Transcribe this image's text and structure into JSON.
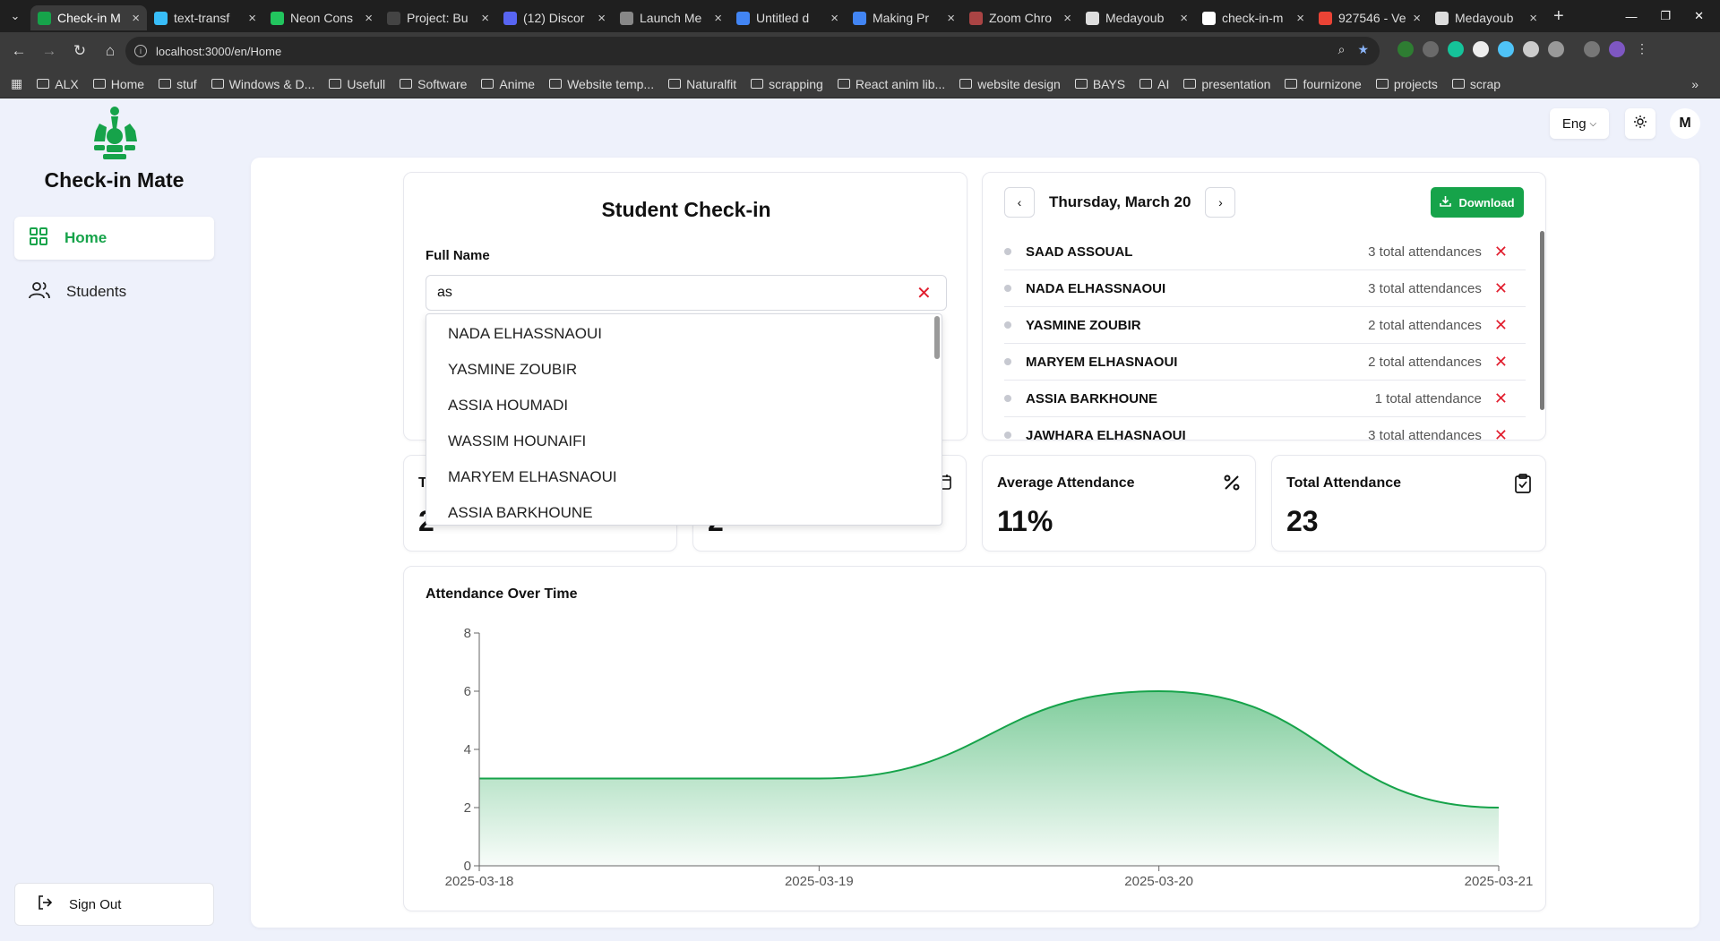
{
  "browser": {
    "tabs": [
      {
        "title": "Check-in M",
        "active": true,
        "color": "#16a34a"
      },
      {
        "title": "text-transf",
        "active": false,
        "color": "#38bdf8"
      },
      {
        "title": "Neon Cons",
        "active": false,
        "color": "#22c55e"
      },
      {
        "title": "Project: Bu",
        "active": false,
        "color": "#444444"
      },
      {
        "title": "(12) Discor",
        "active": false,
        "color": "#5865f2"
      },
      {
        "title": "Launch Me",
        "active": false,
        "color": "#888888"
      },
      {
        "title": "Untitled d",
        "active": false,
        "color": "#4285f4"
      },
      {
        "title": "Making Pr",
        "active": false,
        "color": "#4285f4"
      },
      {
        "title": "Zoom Chro",
        "active": false,
        "color": "#aa4444"
      },
      {
        "title": "Medayoub",
        "active": false,
        "color": "#dddddd"
      },
      {
        "title": "check-in-m",
        "active": false,
        "color": "#ffffff"
      },
      {
        "title": "927546 - Ve",
        "active": false,
        "color": "#ea4335"
      },
      {
        "title": "Medayoub",
        "active": false,
        "color": "#dddddd"
      }
    ],
    "url": "localhost:3000/en/Home",
    "bookmarks": [
      "ALX",
      "Home",
      "stuf",
      "Windows & D...",
      "Usefull",
      "Software",
      "Anime",
      "Website temp...",
      "Naturalfit",
      "scrapping",
      "React anim lib...",
      "website design",
      "BAYS",
      "AI",
      "presentation",
      "fournizone",
      "projects",
      "scrap"
    ]
  },
  "sidebar": {
    "brand": "Check-in Mate",
    "items": [
      {
        "label": "Home",
        "active": true
      },
      {
        "label": "Students",
        "active": false
      }
    ],
    "signout": "Sign Out"
  },
  "header": {
    "language": "Eng",
    "avatar_initial": "M"
  },
  "checkin": {
    "title": "Student Check-in",
    "field_label": "Full Name",
    "input_value": "as",
    "suggestions": [
      "NADA ELHASSNAOUI",
      "YASMINE ZOUBIR",
      "ASSIA HOUMADI",
      "WASSIM HOUNAIFI",
      "MARYEM ELHASNAOUI",
      "ASSIA BARKHOUNE"
    ]
  },
  "attendance_list": {
    "date": "Thursday, March 20",
    "download_label": "Download",
    "rows": [
      {
        "name": "SAAD ASSOUAL",
        "count": "3 total attendances"
      },
      {
        "name": "NADA ELHASSNAOUI",
        "count": "3 total attendances"
      },
      {
        "name": "YASMINE ZOUBIR",
        "count": "2 total attendances"
      },
      {
        "name": "MARYEM ELHASNAOUI",
        "count": "2 total attendances"
      },
      {
        "name": "ASSIA BARKHOUNE",
        "count": "1 total attendance"
      },
      {
        "name": "JAWHARA ELHASNAOUI",
        "count": "3 total attendances"
      }
    ]
  },
  "stats": [
    {
      "title": "T",
      "value": "2",
      "icon": "users-icon"
    },
    {
      "title": "",
      "value": "2",
      "icon": "calendar-icon"
    },
    {
      "title": "Average Attendance",
      "value": "11%",
      "icon": "percent-icon"
    },
    {
      "title": "Total Attendance",
      "value": "23",
      "icon": "clipboard-check-icon"
    }
  ],
  "chart_data": {
    "type": "area",
    "title": "Attendance Over Time",
    "x": [
      "2025-03-18",
      "2025-03-19",
      "2025-03-20",
      "2025-03-21"
    ],
    "values": [
      3,
      3,
      6,
      2
    ],
    "ylim": [
      0,
      8
    ],
    "yticks": [
      0,
      2,
      4,
      6,
      8
    ],
    "color": "#16a34a",
    "grid": false
  },
  "colors": {
    "accent": "#16a34a",
    "danger": "#e11d2d",
    "background": "#eef1fb"
  }
}
